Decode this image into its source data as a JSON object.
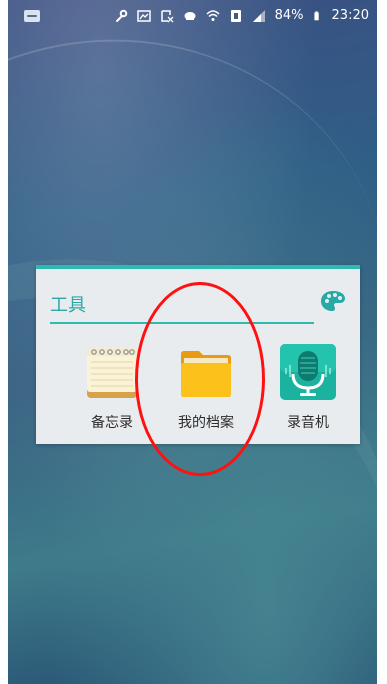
{
  "status_bar": {
    "battery_percent": "84%",
    "time": "23:20",
    "icons": [
      "message-icon",
      "wrench-icon",
      "gallery-icon",
      "screenshot-icon",
      "cloud-icon",
      "wifi-icon",
      "sim-icon",
      "signal-icon",
      "battery-icon"
    ]
  },
  "widget": {
    "title": "工具",
    "accent_color": "#2dbab1",
    "apps": [
      {
        "label": "备忘录",
        "icon": "notepad-icon"
      },
      {
        "label": "我的档案",
        "icon": "folder-icon"
      },
      {
        "label": "录音机",
        "icon": "microphone-icon"
      }
    ]
  },
  "annotation": {
    "color": "#ff1111"
  }
}
